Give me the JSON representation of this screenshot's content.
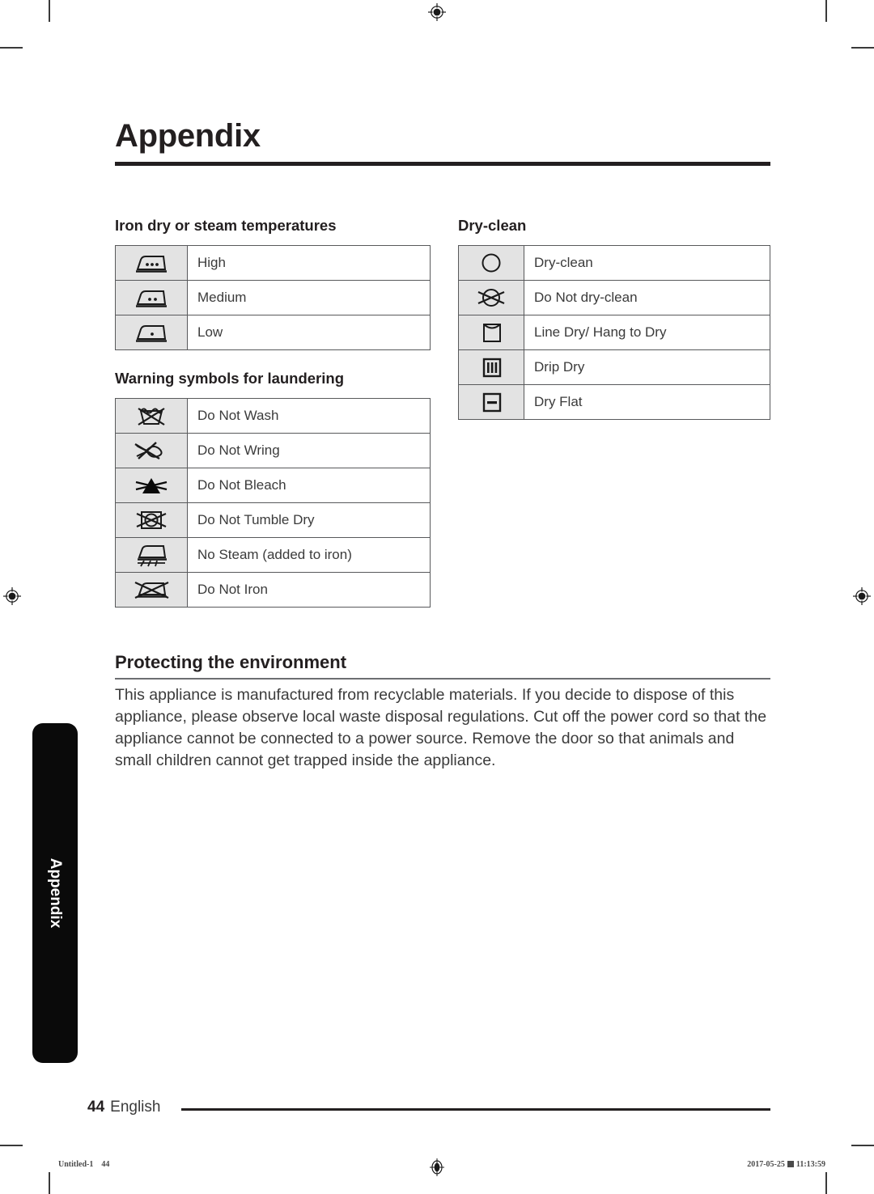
{
  "document": {
    "chapter_title": "Appendix",
    "thumb_tab_label": "Appendix"
  },
  "sections": {
    "iron": {
      "heading": "Iron dry or steam temperatures",
      "rows": [
        {
          "icon": "iron-three-dots-icon",
          "label": "High"
        },
        {
          "icon": "iron-two-dots-icon",
          "label": "Medium"
        },
        {
          "icon": "iron-one-dot-icon",
          "label": "Low"
        }
      ]
    },
    "warning": {
      "heading": "Warning symbols for laundering",
      "rows": [
        {
          "icon": "do-not-wash-icon",
          "label": "Do Not Wash"
        },
        {
          "icon": "do-not-wring-icon",
          "label": "Do Not Wring"
        },
        {
          "icon": "do-not-bleach-icon",
          "label": "Do Not Bleach"
        },
        {
          "icon": "do-not-tumble-dry-icon",
          "label": "Do Not Tumble Dry"
        },
        {
          "icon": "no-steam-icon",
          "label": "No Steam (added to iron)"
        },
        {
          "icon": "do-not-iron-icon",
          "label": "Do Not Iron"
        }
      ]
    },
    "dryclean": {
      "heading": "Dry-clean",
      "rows": [
        {
          "icon": "dry-clean-circle-icon",
          "label": "Dry-clean"
        },
        {
          "icon": "do-not-dry-clean-icon",
          "label": "Do Not dry-clean"
        },
        {
          "icon": "line-dry-icon",
          "label": "Line Dry/ Hang to Dry"
        },
        {
          "icon": "drip-dry-icon",
          "label": "Drip Dry"
        },
        {
          "icon": "dry-flat-icon",
          "label": "Dry Flat"
        }
      ]
    },
    "environment": {
      "heading": "Protecting the environment",
      "body": "This appliance is manufactured from recyclable materials. If you decide to dispose of this appliance, please observe local waste disposal regulations. Cut off the power cord so that the appliance cannot be connected to a power source. Remove the door so that animals and small children cannot get trapped inside the appliance."
    }
  },
  "footer": {
    "page_number": "44",
    "language": "English"
  },
  "press_slug": {
    "file_label": "Untitled-1",
    "file_page": "44",
    "date": "2017-05-25",
    "time": "11:13:59"
  },
  "colors": {
    "ink": "#231f20",
    "body_text": "#3b3b3b",
    "symbol_cell_bg": "#e3e3e3",
    "table_border": "#58595b",
    "tab_bg": "#0a0a0a"
  }
}
